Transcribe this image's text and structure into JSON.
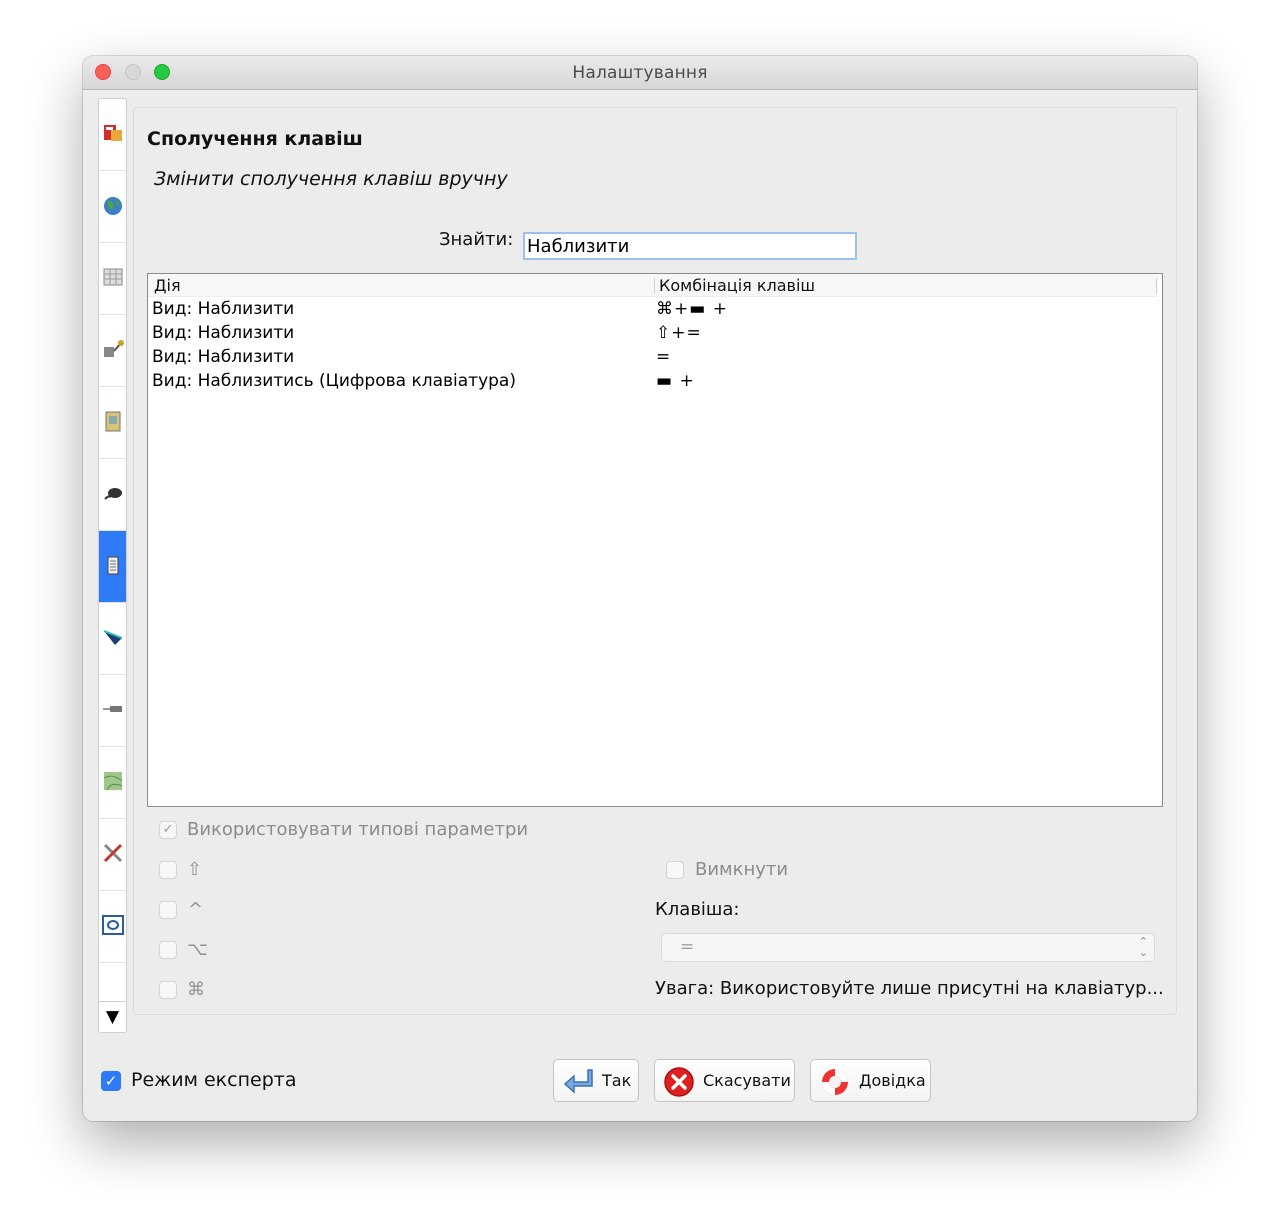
{
  "window": {
    "title": "Налаштування"
  },
  "section": {
    "title": "Сполучення клавіш",
    "subtitle": "Змінити сполучення клавіш вручну"
  },
  "search": {
    "label": "Знайти:",
    "value": "Наблизити"
  },
  "table": {
    "headers": [
      "Дія",
      "Комбінація клавіш"
    ],
    "rows": [
      {
        "action": "Вид: Наблизити",
        "combo": "⌘+▬ +"
      },
      {
        "action": "Вид: Наблизити",
        "combo": "⇧+="
      },
      {
        "action": "Вид: Наблизити",
        "combo": "="
      },
      {
        "action": "Вид: Наблизитись (Цифрова клавіатура)",
        "combo": "▬ +"
      }
    ]
  },
  "options": {
    "use_defaults_label": "Використовувати типові параметри",
    "use_defaults_checked": true,
    "modifiers": [
      "⇧",
      "^",
      "⌥",
      "⌘"
    ],
    "disable_label": "Вимкнути",
    "key_label": "Клавіша:",
    "key_value": "=",
    "warning": "Увага: Використовуйте лише присутні на клавіатур..."
  },
  "footer": {
    "expert_mode_label": "Режим експерта",
    "expert_mode_checked": true,
    "ok_label": "Так",
    "cancel_label": "Скасувати",
    "help_label": "Довідка"
  },
  "sidebar": {
    "icons": [
      "general-settings-icon",
      "globe-icon",
      "grid-icon",
      "network-icon",
      "document-icon",
      "mouse-icon",
      "keyboard-icon",
      "arrow-icon",
      "terminal-icon",
      "map-icon",
      "tools-icon",
      "frame-icon"
    ],
    "active_index": 6,
    "scroll_arrow": "▼"
  },
  "colors": {
    "accent": "#2f7af7",
    "close": "#fe5f57",
    "maximize": "#28c840"
  }
}
